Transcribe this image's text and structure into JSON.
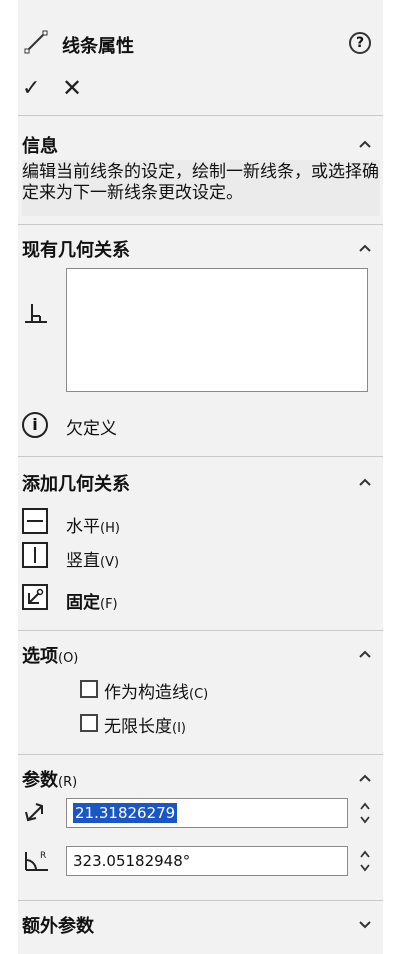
{
  "header": {
    "title": "线条属性",
    "help_symbol": "?",
    "ok_symbol": "✓",
    "cancel_symbol": "✕"
  },
  "info": {
    "title": "信息",
    "text": "编辑当前线条的设定，绘制一新线条，或选择确定来为下一新线条更改设定。"
  },
  "existing_relations": {
    "title": "现有几何关系",
    "status": "欠定义"
  },
  "add_relations": {
    "title": "添加几何关系",
    "items": [
      {
        "label": "水平",
        "shortcut": "(H)"
      },
      {
        "label": "竖直",
        "shortcut": "(V)"
      },
      {
        "label": "固定",
        "shortcut": "(F)"
      }
    ]
  },
  "options": {
    "title": "选项",
    "shortcut": "(O)",
    "items": [
      {
        "label": "作为构造线",
        "shortcut": "(C)",
        "checked": false
      },
      {
        "label": "无限长度",
        "shortcut": "(I)",
        "checked": false
      }
    ]
  },
  "parameters": {
    "title": "参数",
    "shortcut": "(R)",
    "length_value": "21.31826279",
    "angle_value": "323.05182948°"
  },
  "extra_parameters": {
    "title": "额外参数"
  }
}
